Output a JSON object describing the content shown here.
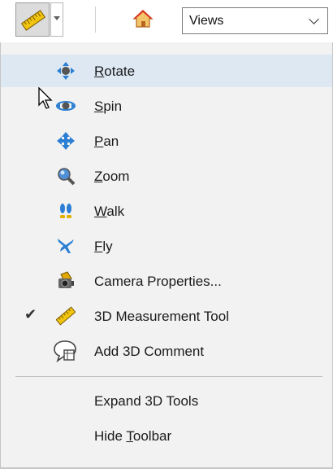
{
  "toolbar": {
    "tool_icon": "ruler-icon",
    "home_icon": "home-icon",
    "views_select": {
      "value": "Views"
    }
  },
  "menu": {
    "items": [
      {
        "label": "Rotate",
        "mnemonic": "R",
        "rest": "otate",
        "icon": "rotate-icon",
        "highlighted": true
      },
      {
        "label": "Spin",
        "mnemonic": "S",
        "rest": "pin",
        "icon": "spin-icon"
      },
      {
        "label": "Pan",
        "mnemonic": "P",
        "rest": "an",
        "icon": "pan-icon"
      },
      {
        "label": "Zoom",
        "mnemonic": "Z",
        "rest": "oom",
        "icon": "zoom-icon"
      },
      {
        "label": "Walk",
        "mnemonic": "W",
        "rest": "alk",
        "icon": "walk-icon"
      },
      {
        "label": "Fly",
        "mnemonic": "F",
        "rest": "ly",
        "icon": "fly-icon"
      },
      {
        "label": "Camera Properties...",
        "icon": "camera-icon"
      },
      {
        "label": "3D Measurement Tool",
        "icon": "ruler-icon",
        "checked": true,
        "check": "✔"
      },
      {
        "label": "Add 3D Comment",
        "icon": "comment-icon"
      },
      {
        "label": "Expand 3D Tools"
      },
      {
        "label": "Hide Toolbar",
        "pre": "Hide ",
        "mnemonic": "T",
        "rest": "oolbar"
      }
    ]
  },
  "colors": {
    "menu_bg": "#f2f2f2",
    "highlight_bg": "#dde8f3",
    "tool_blue": "#2b7fd4"
  }
}
